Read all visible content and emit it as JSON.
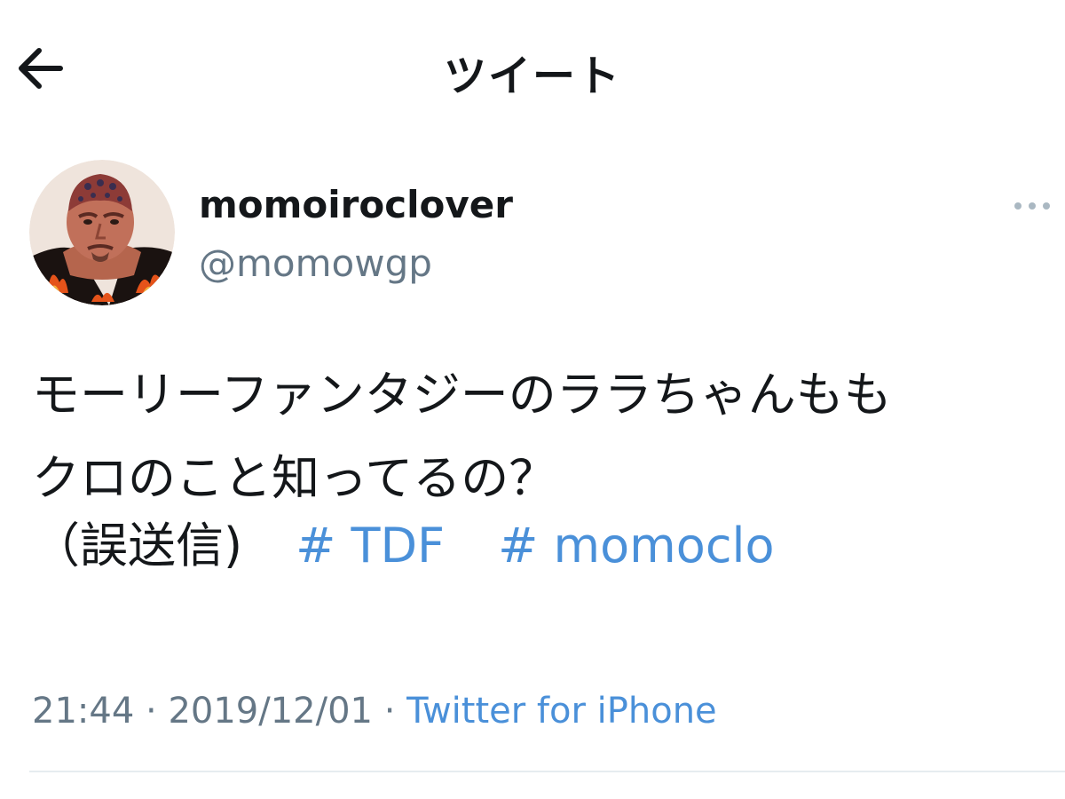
{
  "header": {
    "title": "ツイート",
    "back_icon": "arrow-left-icon"
  },
  "tweet": {
    "display_name": "momoiroclover",
    "handle": "@momowgp",
    "text_line1": "モーリーファンタジーのララちゃんもも",
    "text_line2": "クロのこと知ってるの？",
    "text_line3_prefix": "（誤送信)",
    "hashtags": [
      "# TDF",
      "# momoclo"
    ],
    "time": "21:44",
    "separator": "·",
    "date": "2019/12/01",
    "source": "Twitter for iPhone",
    "more_icon": "more-horizontal-icon"
  },
  "colors": {
    "link": "#4a90d9",
    "secondary_text": "#657786",
    "primary_text": "#14171a",
    "divider": "#e6ecf0"
  }
}
